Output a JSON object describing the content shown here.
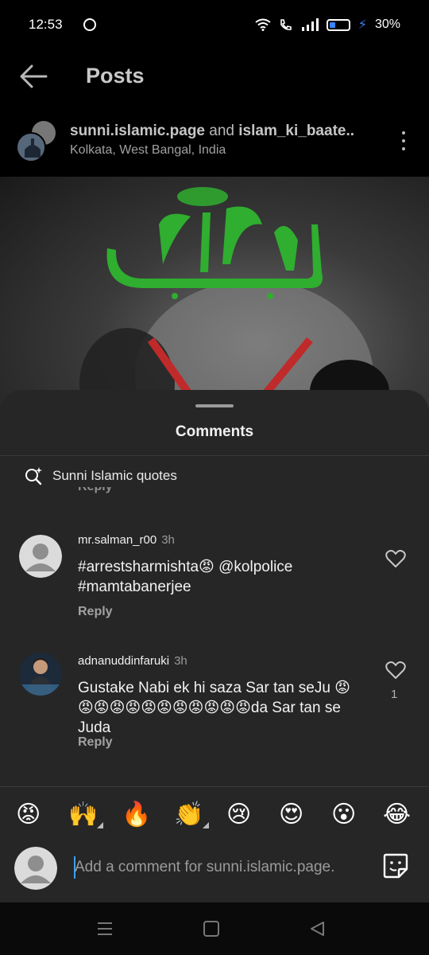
{
  "status_bar": {
    "time": "12:53",
    "battery": "30%",
    "battery_level": 0.3
  },
  "header": {
    "title": "Posts"
  },
  "post": {
    "owner_primary": "sunni.islamic.page",
    "owner_joiner": "and",
    "owner_secondary": "islam_ki_baate..",
    "location": "Kolkata, West Bangal, India"
  },
  "comments_sheet": {
    "title": "Comments",
    "suggestion": "Sunni Islamic quotes",
    "prev_reply_label": "Reply",
    "comments": [
      {
        "username": "mr.salman_r00",
        "time": "3h",
        "text": "#arrestsharmishta😡 @kolpolice #mamtabanerjee",
        "reply_label": "Reply",
        "likes": ""
      },
      {
        "username": "adnanuddinfaruki",
        "time": "3h",
        "text": "Gustake Nabi ek hi saza Sar tan seJu 😡😡😡😡😡😡😡😡😡😡😡😡da Sar tan se Juda",
        "reply_label": "Reply",
        "likes": "1"
      }
    ]
  },
  "emoji_bar": {
    "emojis": [
      "😡",
      "🙌",
      "🔥",
      "👏",
      "😢",
      "😍",
      "😮",
      "😂"
    ]
  },
  "composer": {
    "placeholder": "Add a comment for sunni.islamic.page."
  },
  "colors": {
    "sheet_bg": "#262626",
    "accent_blue": "#3aa0ff",
    "calligraphy_green": "#2fae2f"
  },
  "icons": {
    "back": "arrow-left-icon",
    "more": "kebab-menu-icon",
    "search": "sparkle-search-icon",
    "like": "heart-outline-icon",
    "sticker": "sticker-icon",
    "nav_menu": "menu-lines-icon",
    "nav_home": "square-icon",
    "nav_back": "triangle-back-icon"
  }
}
